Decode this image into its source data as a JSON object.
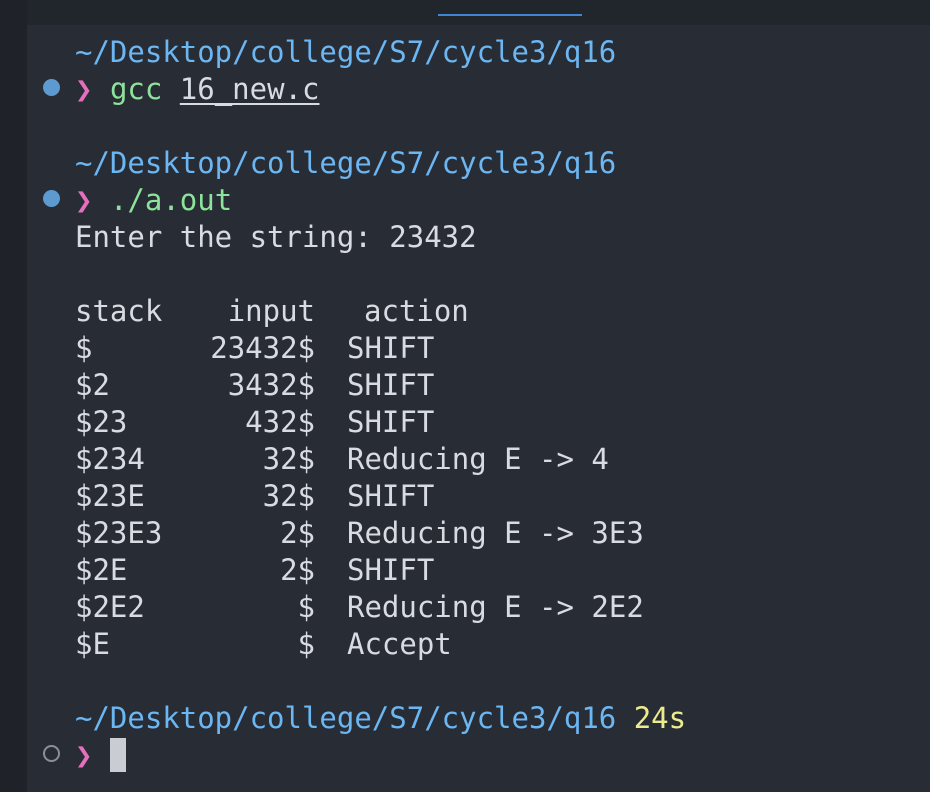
{
  "terminal": {
    "blocks": [
      {
        "path": "~/Desktop/college/S7/cycle3/q16",
        "prompt": "❯",
        "command": "gcc",
        "argument": "16_new.c"
      },
      {
        "path": "~/Desktop/college/S7/cycle3/q16",
        "prompt": "❯",
        "command": "./a.out",
        "output_prompt": "Enter the string: 23432"
      }
    ],
    "table": {
      "headers": {
        "stack": "stack",
        "input": "input",
        "action": "action"
      },
      "rows": [
        {
          "stack": "$",
          "input": "23432$",
          "action": "SHIFT"
        },
        {
          "stack": "$2",
          "input": "3432$",
          "action": "SHIFT"
        },
        {
          "stack": "$23",
          "input": "432$",
          "action": "SHIFT"
        },
        {
          "stack": "$234",
          "input": "32$",
          "action": "Reducing E -> 4"
        },
        {
          "stack": "$23E",
          "input": "32$",
          "action": "SHIFT"
        },
        {
          "stack": "$23E3",
          "input": "2$",
          "action": "Reducing E -> 3E3"
        },
        {
          "stack": "$2E",
          "input": "2$",
          "action": "SHIFT"
        },
        {
          "stack": "$2E2",
          "input": "$",
          "action": "Reducing E -> 2E2"
        },
        {
          "stack": "$E",
          "input": "$",
          "action": "Accept"
        }
      ]
    },
    "final": {
      "path": "~/Desktop/college/S7/cycle3/q16",
      "duration": "24s",
      "prompt": "❯"
    }
  },
  "colors": {
    "path": "#6cb6f2",
    "prompt": "#e36fbd",
    "command": "#8ee39a",
    "duration": "#ecec8e",
    "background": "#282c35"
  }
}
